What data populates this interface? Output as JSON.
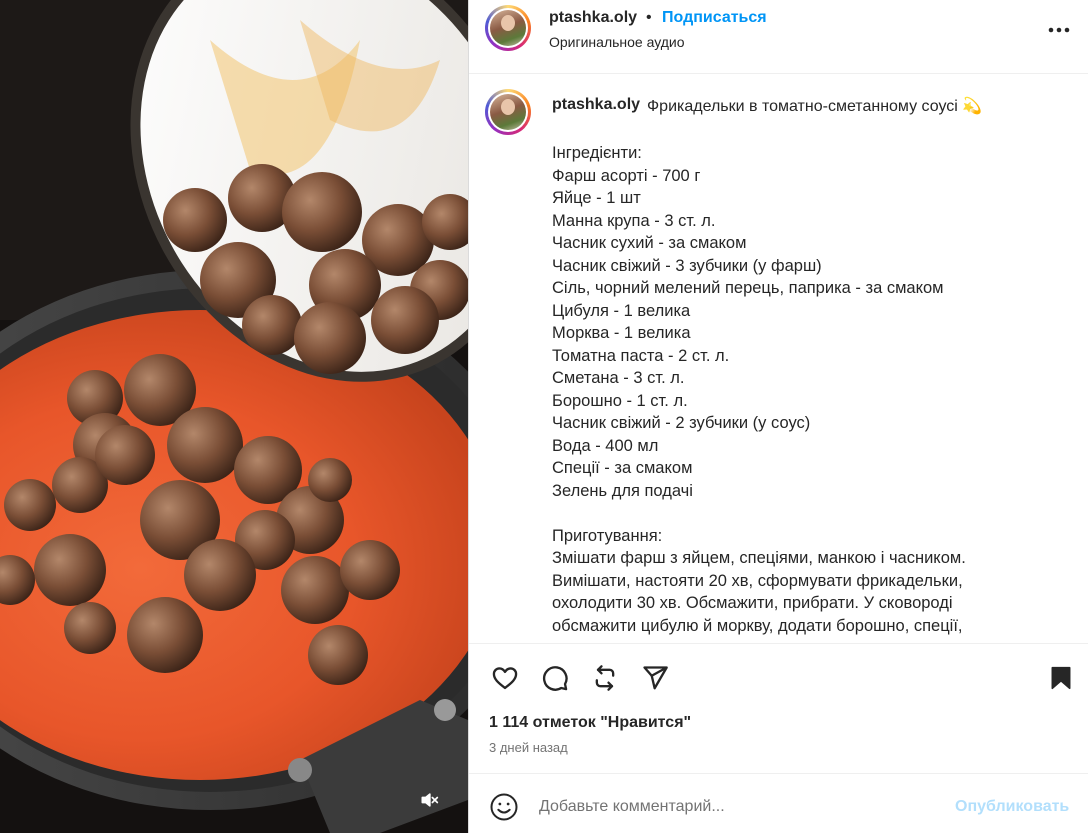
{
  "header": {
    "username": "ptashka.oly",
    "separator": "•",
    "follow_label": "Подписаться",
    "audio_label": "Оригинальное аудио",
    "more_icon": "more-horizontal-icon"
  },
  "caption": {
    "username": "ptashka.oly",
    "title": "Фрикадельки в томатно-сметанному соусі 💫",
    "ingredients_heading": "Інгредієнти:",
    "ingredients": [
      "Фарш асорті - 700 г",
      "Яйце - 1 шт",
      "Манна крупа - 3 ст. л.",
      "Часник сухий - за смаком",
      "Часник свіжий - 3 зубчики (у фарш)",
      "Сіль, чорний мелений перець, паприка - за смаком",
      "Цибуля - 1 велика",
      "Морква - 1 велика",
      "Томатна паста - 2 ст. л.",
      "Сметана - 3 ст. л.",
      "Борошно - 1 ст. л.",
      "Часник свіжий - 2 зубчики (у соус)",
      "Вода - 400 мл",
      "Спеції - за смаком",
      "Зелень для подачі"
    ],
    "method_heading": "Приготування:",
    "method_lines": [
      "Змішати фарш з яйцем, спеціями, манкою і часником.",
      "Вимішати, настояти 20 хв, сформувати фрикадельки,",
      "охолодити 30 хв. Обсмажити, прибрати. У сковороді",
      "обсмажити цибулю й моркву, додати борошно, спеції,"
    ]
  },
  "actions": {
    "icons": [
      "heart-icon",
      "comment-icon",
      "repost-icon",
      "share-icon",
      "bookmark-icon"
    ],
    "likes": "1 114 отметок \"Нравится\"",
    "time": "3 дней назад"
  },
  "comment": {
    "placeholder": "Добавьте комментарий...",
    "publish_label": "Опубликовать"
  },
  "media": {
    "sound_icon": "sound-muted-icon"
  },
  "colors": {
    "link_blue": "#0095f6",
    "publish_disabled": "#b2dffc",
    "sauce": "#e8562a"
  }
}
